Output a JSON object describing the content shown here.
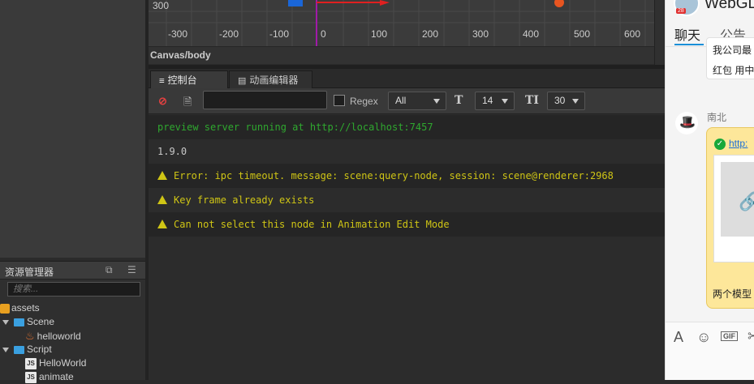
{
  "scene": {
    "ruler_top_label": "300",
    "x_ticks": [
      "-300",
      "-200",
      "-100",
      "0",
      "100",
      "200",
      "300",
      "400",
      "500",
      "600"
    ],
    "canvas_path": "Canvas/body"
  },
  "console": {
    "tabs": [
      {
        "label": "控制台",
        "icon": "console-icon"
      },
      {
        "label": "动画编辑器",
        "icon": "animation-editor-icon"
      }
    ],
    "toolbar": {
      "clear_icon": "clear-icon",
      "open_log_icon": "document-icon",
      "filter_value": "",
      "regex_label": "Regex",
      "level_select": "All",
      "font_size_select": "14",
      "line_height_select": "30"
    },
    "logs": [
      {
        "text": "preview server running at http://localhost:7457",
        "level": "info",
        "color": "#2fa82f"
      },
      {
        "text": "1.9.0",
        "level": "log",
        "color": "#c8c8c8"
      },
      {
        "text": "Error: ipc timeout. message: scene:query-node, session: scene@renderer:2968",
        "level": "warn",
        "color": "#cfc515"
      },
      {
        "text": "Key frame already exists",
        "level": "warn",
        "color": "#cfc515"
      },
      {
        "text": "Can not select this node in Animation Edit Mode",
        "level": "warn",
        "color": "#cfc515"
      }
    ]
  },
  "assets": {
    "title": "资源管理器",
    "search_placeholder": "搜索...",
    "tree": [
      {
        "label": "assets",
        "depth": 0,
        "kind": "root"
      },
      {
        "label": "Scene",
        "depth": 1,
        "kind": "folder"
      },
      {
        "label": "helloworld",
        "depth": 2,
        "kind": "scene"
      },
      {
        "label": "Script",
        "depth": 1,
        "kind": "folder"
      },
      {
        "label": "HelloWorld",
        "depth": 2,
        "kind": "js"
      },
      {
        "label": "animate",
        "depth": 2,
        "kind": "js"
      }
    ]
  },
  "chat": {
    "title": "WebGL",
    "badge": "28",
    "tabs": [
      "聊天",
      "公告"
    ],
    "msg1_line1": "我公司最",
    "msg1_line2": "红包  用中",
    "sender": "南北",
    "link": "http:",
    "caption": "两个模型",
    "accent": "#1a8fd8"
  }
}
